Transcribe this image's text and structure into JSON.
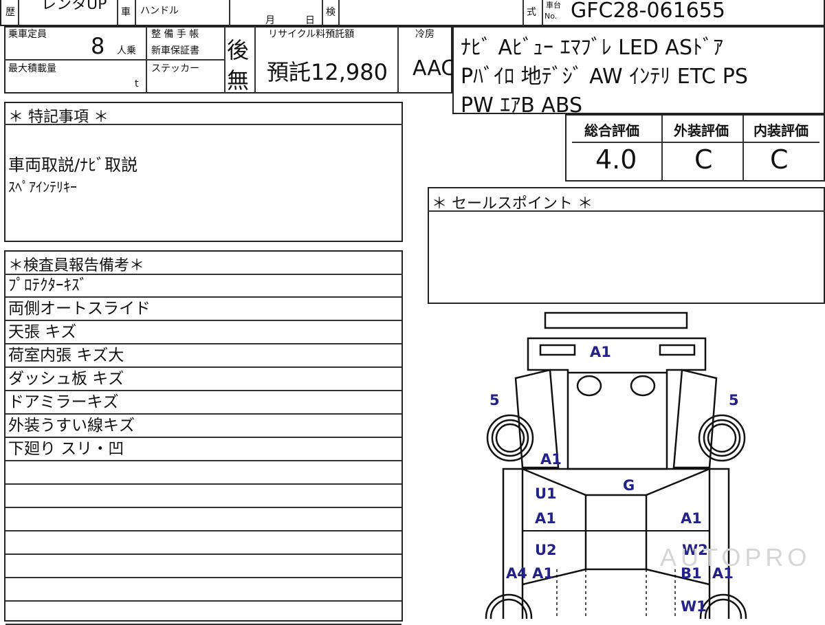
{
  "header": {
    "hist_label": "歴",
    "hist_value": "レンタUP",
    "car_label": "車",
    "handle_label": "ハンドル",
    "month_label": "月",
    "day_label": "日",
    "inspect_label": "検",
    "model_label": "式",
    "chassis_label_top": "車台",
    "chassis_label_no": "No.",
    "chassis_no": "GFC28-061655"
  },
  "specs": {
    "capacity_label": "乗車定員",
    "capacity_value": "8",
    "capacity_unit": "人乗",
    "maint_label_1": "整 備 手 帳",
    "maint_label_2": "新車保証書",
    "maint_value": "後",
    "load_label": "最大積載量",
    "load_unit": "t",
    "sticker_label": "ステッカー",
    "sticker_value": "無",
    "recycle_label": "リサイクル料預託額",
    "recycle_value": "預託12,980",
    "ac_label": "冷房",
    "ac_value": "AAC"
  },
  "equipment": {
    "line1": "ﾅﾋﾞ Aﾋﾞｭｰ ｴﾏﾌﾞﾚ LED ASﾄﾞｱ",
    "line2": "Pﾊﾞｲﾛ 地ﾃﾞｼﾞ AW ｲﾝﾃﾘ ETC PS",
    "line3": "PW ｴｱB ABS"
  },
  "ratings": {
    "overall_label": "総合評価",
    "overall_value": "4.0",
    "exterior_label": "外装評価",
    "exterior_value": "C",
    "interior_label": "内装評価",
    "interior_value": "C"
  },
  "special": {
    "title": "＊ 特記事項 ＊",
    "line1": "車両取説/ﾅﾋﾞ取説",
    "line2": "ｽﾍﾟｱｲﾝﾃﾘｷｰ"
  },
  "sales_point": {
    "title": "＊ セールスポイント ＊"
  },
  "inspector": {
    "title": "＊検査員報告備考＊",
    "rows": [
      "ﾌﾟﾛﾃｸﾀｰｷｽﾞ",
      "両側オートスライド",
      "天張 キズ",
      "荷室内張 キズ大",
      "ダッシュ板 キズ",
      "ドアミラーキズ",
      "外装うすい線キズ",
      "下廻り スリ・凹",
      "",
      "",
      "",
      "",
      "",
      "",
      ""
    ]
  },
  "diagram_marks": {
    "m1": "A1",
    "m2": "5",
    "m3": "5",
    "m4": "A1",
    "m5": "G",
    "m6": "U1",
    "m7": "A1",
    "m8": "A1",
    "m9": "U2",
    "m10": "W2",
    "m11": "A4 A1",
    "m12": "B1",
    "m13": "A1",
    "m14": "W1"
  },
  "watermark": "AUTOPRO"
}
